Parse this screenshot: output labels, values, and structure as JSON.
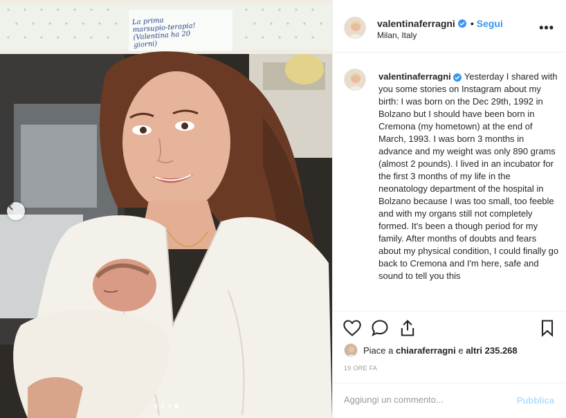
{
  "post": {
    "username": "valentinaferragni",
    "separator": "•",
    "follow_label": "Segui",
    "location": "Milan, Italy",
    "more_label": "•••",
    "caption_text": "Yesterday I shared with you some stories on Instagram about my birth: I was born on the Dec 29th, 1992 in Bolzano but I should have been born in Cremona (my hometown) at the end of March, 1993. I was born 3 months in advance and my weight was only 890 grams (almost 2 pounds). I lived in an incubator for the first 3 months of my life in the neonatology department of the hospital in Bolzano because I was too small, too feeble and with my organs still not completely formed. It's been a though period for my family. After months of doubts and fears about my physical condition, I could finally go back to Cremona and I'm here, safe and sound to tell you this",
    "likes_prefix": "Piace a",
    "likes_user": "chiaraferragni",
    "likes_suffix": "e",
    "likes_others": "altri 235.268",
    "time_ago": "19 ORE FA"
  },
  "photo": {
    "handwritten_note": [
      "La prima",
      "marsupio-terapia!",
      "(Valentina ha 20",
      "giorni)"
    ],
    "carousel": {
      "total": 4,
      "active": 4
    }
  },
  "comment": {
    "placeholder": "Aggiungi un commento...",
    "publish_label": "Pubblica"
  },
  "icons": {
    "verified": "verified-badge-icon",
    "like": "heart-icon",
    "comment": "comment-bubble-icon",
    "share": "share-icon",
    "save": "bookmark-icon",
    "prev": "chevron-left-icon"
  },
  "colors": {
    "link": "#3897f0",
    "publish_disabled": "#b2dffc",
    "muted": "#999999",
    "text": "#262626"
  }
}
